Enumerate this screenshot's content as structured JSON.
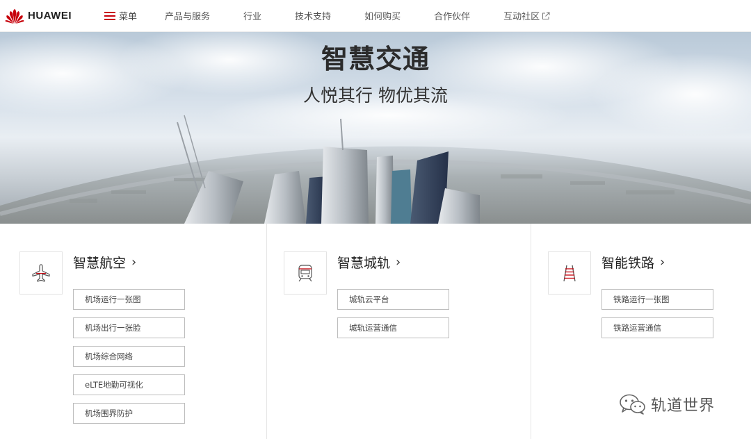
{
  "header": {
    "brand": "HUAWEI",
    "menu_label": "菜单",
    "nav": [
      {
        "label": "产品与服务"
      },
      {
        "label": "行业"
      },
      {
        "label": "技术支持"
      },
      {
        "label": "如何购买"
      },
      {
        "label": "合作伙伴"
      },
      {
        "label": "互动社区"
      }
    ]
  },
  "hero": {
    "title": "智慧交通",
    "subtitle": "人悦其行 物优其流"
  },
  "cards": [
    {
      "title": "智慧航空",
      "chevron": "›",
      "icon": "airplane-icon",
      "links": [
        "机场运行一张图",
        "机场出行一张脸",
        "机场综合网络",
        "eLTE地勤可视化",
        "机场围界防护"
      ]
    },
    {
      "title": "智慧城轨",
      "chevron": "›",
      "icon": "metro-train-icon",
      "links": [
        "城轨云平台",
        "城轨运营通信"
      ]
    },
    {
      "title": "智能铁路",
      "chevron": "›",
      "icon": "railway-track-icon",
      "links": [
        "铁路运行一张图",
        "铁路运营通信"
      ]
    }
  ],
  "watermark": {
    "text": "轨道世界",
    "icon": "wechat-icon"
  },
  "colors": {
    "brand_red": "#c7000b",
    "icon_red": "#c7000b"
  }
}
